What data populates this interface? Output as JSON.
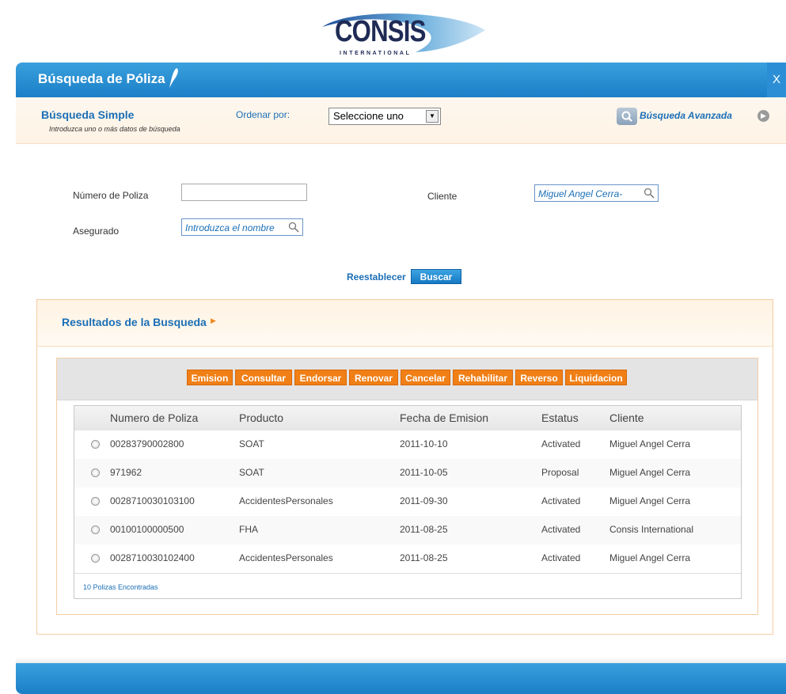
{
  "logo": {
    "name": "CONSIS",
    "tagline": "INTERNATIONAL"
  },
  "header": {
    "title": "Búsqueda de Póliza",
    "close_label": "X"
  },
  "search": {
    "title": "Búsqueda Simple",
    "subtitle": "Introduzca uno o más datos de búsqueda",
    "order_label": "Ordenar por:",
    "order_value": "Seleccione uno",
    "advanced_label": "Búsqueda Avanzada"
  },
  "form": {
    "policy_label": "Número de Poliza",
    "policy_value": "",
    "client_label": "Cliente",
    "client_value": "Miguel Angel Cerra-",
    "insured_label": "Asegurado",
    "insured_placeholder": "Introduzca el nombre",
    "reset_label": "Reestablecer",
    "search_label": "Buscar"
  },
  "results": {
    "title": "Resultados de la Busqueda",
    "actions": [
      "Emision",
      "Consultar",
      "Endorsar",
      "Renovar",
      "Cancelar",
      "Rehabilitar",
      "Reverso",
      "Liquidacion"
    ],
    "columns": [
      "Numero de Poliza",
      "Producto",
      "Fecha de Emision",
      "Estatus",
      "Cliente"
    ],
    "rows": [
      [
        "00283790002800",
        "SOAT",
        "2011-10-10",
        "Activated",
        "Miguel Angel Cerra"
      ],
      [
        "971962",
        "SOAT",
        "2011-10-05",
        "Proposal",
        "Miguel Angel Cerra"
      ],
      [
        "0028710030103100",
        "AccidentesPersonales",
        "2011-09-30",
        "Activated",
        "Miguel Angel Cerra"
      ],
      [
        "00100100000500",
        "FHA",
        "2011-08-25",
        "Activated",
        "Consis International"
      ],
      [
        "0028710030102400",
        "AccidentesPersonales",
        "2011-08-25",
        "Activated",
        "Miguel Angel Cerra"
      ]
    ],
    "found_label": "10 Polizas Encontradas"
  },
  "colors": {
    "primary": "#1b7fc7",
    "accent": "#f07f16",
    "link": "#1b6fb6"
  }
}
